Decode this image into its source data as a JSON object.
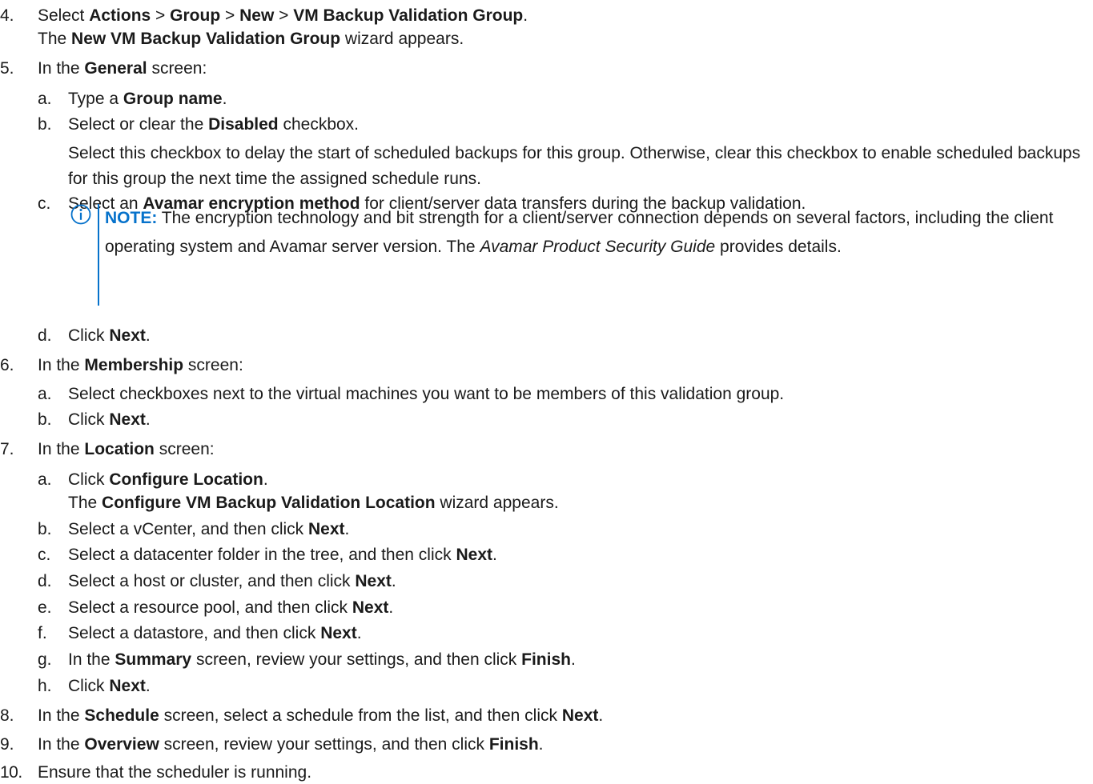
{
  "steps": {
    "s4": {
      "num": "4.",
      "t1": "Select ",
      "b1": "Actions",
      "t2": " > ",
      "b2": "Group",
      "t3": " > ",
      "b3": "New",
      "t4": " > ",
      "b4": "VM Backup Validation Group",
      "t5": ".",
      "l2_t1": "The ",
      "l2_b1": "New VM Backup Validation Group",
      "l2_t2": " wizard appears."
    },
    "s5": {
      "num": "5.",
      "t1": "In the ",
      "b1": "General",
      "t2": " screen:",
      "a": {
        "num": "a.",
        "t1": "Type a ",
        "b1": "Group name",
        "t2": "."
      },
      "b": {
        "num": "b.",
        "t1": "Select or clear the ",
        "b1": "Disabled",
        "t2": " checkbox.",
        "para": "Select this checkbox to delay the start of scheduled backups for this group. Otherwise, clear this checkbox to enable scheduled backups for this group the next time the assigned schedule runs."
      },
      "c": {
        "num": "c.",
        "t1": "Select an ",
        "b1": "Avamar encryption method",
        "t2": " for client/server data transfers during the backup validation."
      },
      "note": {
        "label": "NOTE:",
        "t1": " The encryption technology and bit strength for a client/server connection depends on several factors, including the client operating system and Avamar server version. The ",
        "i1": "Avamar Product Security Guide",
        "t2": " provides details."
      },
      "d": {
        "num": "d.",
        "t1": "Click ",
        "b1": "Next",
        "t2": "."
      }
    },
    "s6": {
      "num": "6.",
      "t1": "In the ",
      "b1": "Membership",
      "t2": " screen:",
      "a": {
        "num": "a.",
        "t1": "Select checkboxes next to the virtual machines you want to be members of this validation group."
      },
      "b": {
        "num": "b.",
        "t1": "Click ",
        "b1": "Next",
        "t2": "."
      }
    },
    "s7": {
      "num": "7.",
      "t1": "In the ",
      "b1": "Location",
      "t2": " screen:",
      "a": {
        "num": "a.",
        "t1": "Click ",
        "b1": "Configure Location",
        "t2": ".",
        "l2_t1": "The ",
        "l2_b1": "Configure VM Backup Validation Location",
        "l2_t2": " wizard appears."
      },
      "b": {
        "num": "b.",
        "t1": "Select a vCenter, and then click ",
        "b1": "Next",
        "t2": "."
      },
      "c": {
        "num": "c.",
        "t1": "Select a datacenter folder in the tree, and then click ",
        "b1": "Next",
        "t2": "."
      },
      "d": {
        "num": "d.",
        "t1": "Select a host or cluster, and then click ",
        "b1": "Next",
        "t2": "."
      },
      "e": {
        "num": "e.",
        "t1": "Select a resource pool, and then click ",
        "b1": "Next",
        "t2": "."
      },
      "f": {
        "num": "f.",
        "t1": "Select a datastore, and then click ",
        "b1": "Next",
        "t2": "."
      },
      "g": {
        "num": "g.",
        "t1": "In the ",
        "b1": "Summary",
        "t2": " screen, review your settings, and then click ",
        "b2": "Finish",
        "t3": "."
      },
      "h": {
        "num": "h.",
        "t1": "Click ",
        "b1": "Next",
        "t2": "."
      }
    },
    "s8": {
      "num": "8.",
      "t1": "In the ",
      "b1": "Schedule",
      "t2": " screen, select a schedule from the list, and then click ",
      "b2": "Next",
      "t3": "."
    },
    "s9": {
      "num": "9.",
      "t1": "In the ",
      "b1": "Overview",
      "t2": " screen, review your settings, and then click ",
      "b2": "Finish",
      "t3": "."
    },
    "s10": {
      "num": "10.",
      "t1": "Ensure that the scheduler is running."
    }
  },
  "colors": {
    "note_accent": "#0672CB",
    "text": "#1a1a1a"
  },
  "icons": {
    "note": "info-icon"
  }
}
